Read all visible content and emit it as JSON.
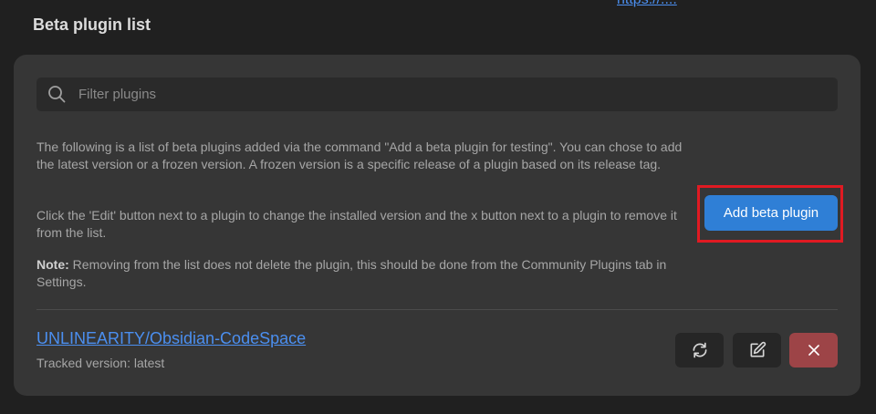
{
  "top_link": {
    "text": "https://...."
  },
  "section": {
    "heading": "Beta plugin list"
  },
  "search": {
    "placeholder": "Filter plugins",
    "value": ""
  },
  "description": {
    "paragraph_1": "The following is a list of beta plugins added via the command \"Add a beta plugin for testing\". You can chose to add the latest version or a frozen version. A frozen version is a specific release of a plugin based on its release tag.",
    "paragraph_2": "Click the 'Edit' button next to a plugin to change the installed version and the x button next to a plugin to remove it from the list.",
    "note_label": "Note:",
    "note_text": " Removing from the list does not delete the plugin, this should be done from the Community Plugins tab in Settings."
  },
  "add_button": {
    "label": "Add beta plugin"
  },
  "plugins": [
    {
      "name": "UNLINEARITY/Obsidian-CodeSpace",
      "version": "Tracked version: latest"
    }
  ],
  "icons": {
    "search": "search-icon",
    "update": "refresh-icon",
    "edit": "edit-icon",
    "remove": "close-icon"
  },
  "colors": {
    "accent": "#2f7fd6",
    "link": "#4b8ff0",
    "remove_button": "#9d4447",
    "highlight": "#e01a22"
  }
}
